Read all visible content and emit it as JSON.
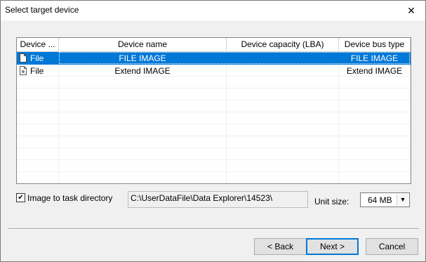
{
  "window": {
    "title": "Select target device",
    "close_glyph": "✕"
  },
  "columns": [
    "Device ...",
    "Device name",
    "Device capacity (LBA)",
    "Device bus type"
  ],
  "rows": [
    {
      "device": "File",
      "name": "FILE IMAGE",
      "capacity": "",
      "bus": "FILE IMAGE",
      "selected": true
    },
    {
      "device": "File",
      "name": "Extend IMAGE",
      "capacity": "",
      "bus": "Extend IMAGE",
      "selected": false
    }
  ],
  "options": {
    "image_to_task_label": "Image to task directory",
    "image_to_task_checked": true,
    "path_value": "C:\\UserDataFile\\Data Explorer\\14523\\",
    "unit_size_label": "Unit size:",
    "unit_size_value": "64 MB"
  },
  "buttons": {
    "back": "< Back",
    "next": "Next >",
    "cancel": "Cancel"
  },
  "colors": {
    "selection": "#0078d7"
  }
}
